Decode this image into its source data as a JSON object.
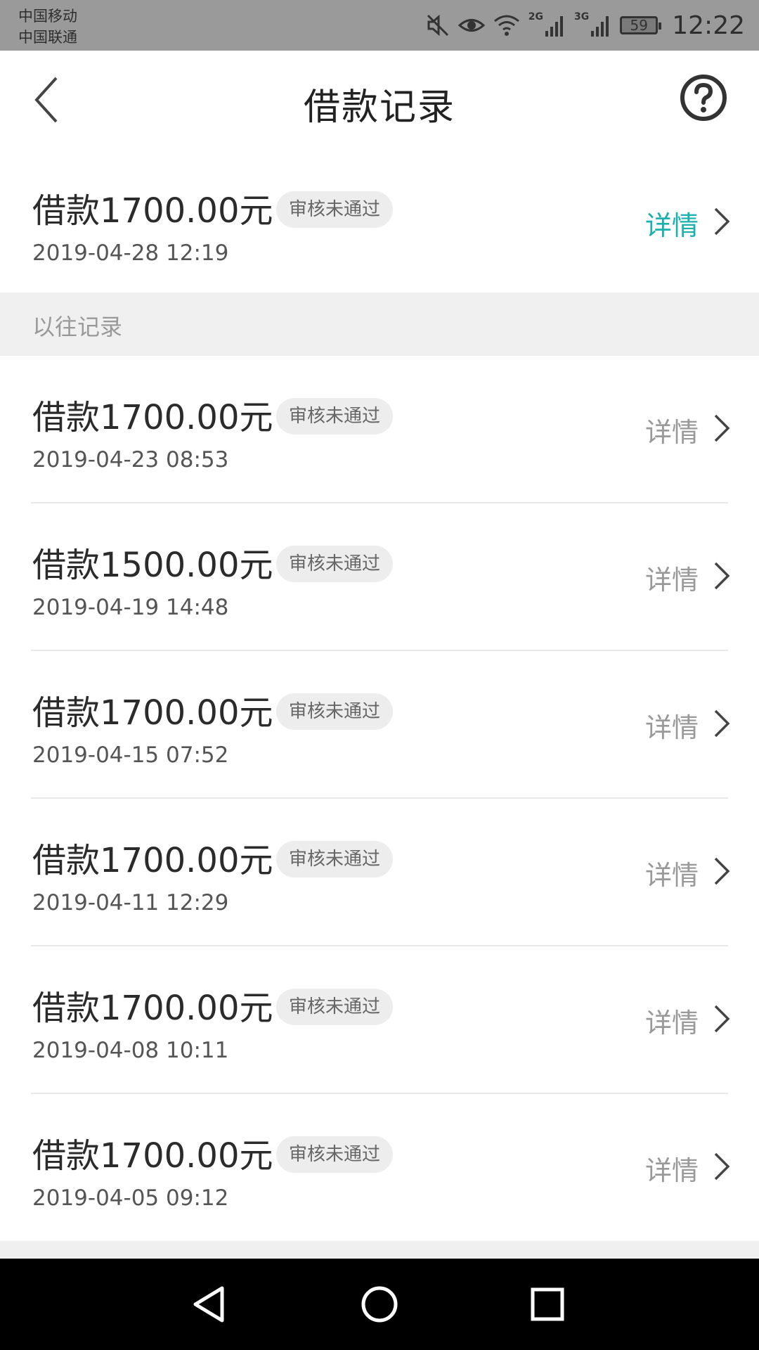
{
  "status_bar": {
    "carrier_1": "中国移动",
    "carrier_2": "中国联通",
    "net_2g": "2G",
    "net_3g": "3G",
    "battery": "59",
    "time": "12:22"
  },
  "header": {
    "title": "借款记录"
  },
  "current_record": {
    "amount": "借款1700.00元",
    "status": "审核未通过",
    "date": "2019-04-28 12:19",
    "detail_label": "详情"
  },
  "section": {
    "label": "以往记录"
  },
  "past_records": [
    {
      "amount": "借款1700.00元",
      "status": "审核未通过",
      "date": "2019-04-23 08:53",
      "detail_label": "详情"
    },
    {
      "amount": "借款1500.00元",
      "status": "审核未通过",
      "date": "2019-04-19 14:48",
      "detail_label": "详情"
    },
    {
      "amount": "借款1700.00元",
      "status": "审核未通过",
      "date": "2019-04-15 07:52",
      "detail_label": "详情"
    },
    {
      "amount": "借款1700.00元",
      "status": "审核未通过",
      "date": "2019-04-11 12:29",
      "detail_label": "详情"
    },
    {
      "amount": "借款1700.00元",
      "status": "审核未通过",
      "date": "2019-04-08 10:11",
      "detail_label": "详情"
    },
    {
      "amount": "借款1700.00元",
      "status": "审核未通过",
      "date": "2019-04-05 09:12",
      "detail_label": "详情"
    }
  ],
  "colors": {
    "accent": "#1ab0ae",
    "status_bar_bg": "#9a9a9a",
    "section_bg": "#f0f0f0",
    "badge_bg": "#ededed"
  },
  "icons": {
    "back": "back-arrow-icon",
    "help": "question-circle-icon",
    "chevron": "chevron-right-icon",
    "nav_back": "triangle-back-icon",
    "nav_home": "circle-home-icon",
    "nav_recents": "square-recents-icon"
  }
}
